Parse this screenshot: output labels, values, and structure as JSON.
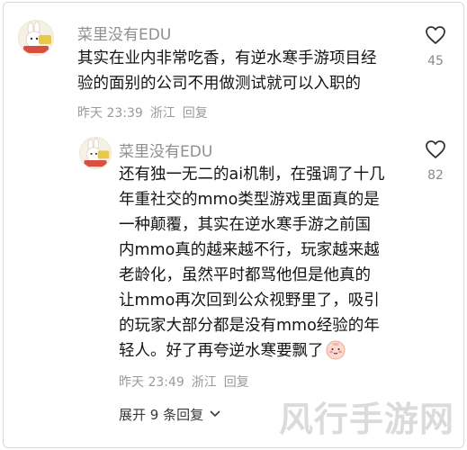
{
  "comments": [
    {
      "username": "菜里没有EDU",
      "avatar_badge": "小福篮",
      "lines": [
        "其实在业内非常吃香，有逆水寒手游项目经",
        "验的面别的公司不用做测试就可以入职的"
      ],
      "time": "昨天 23:39",
      "location": "浙江",
      "reply_label": "回复",
      "like_count": "45",
      "like_icon": "heart-outline-icon"
    },
    {
      "username": "菜里没有EDU",
      "avatar_badge": "小福篮",
      "lines": [
        "还有独一无二的ai机制，在强调了十几",
        "年重社交的mmo类型游戏里面真的是",
        "一种颠覆，其实在逆水寒手游之前国",
        "内mmo真的越来越不行，玩家越来越",
        "老龄化，虽然平时都骂他但是他真的",
        "让mmo再次回到公众视野里了，吸引",
        "的玩家大部分都是没有mmo经验的年",
        "轻人。好了再夸逆水寒要飘了"
      ],
      "time": "昨天 23:49",
      "location": "浙江",
      "reply_label": "回复",
      "like_count": "82",
      "like_icon": "heart-outline-icon",
      "emoji_icon": "blush-face-icon"
    }
  ],
  "expand_replies": "展开 9 条回复",
  "expand_icon": "chevron-down-icon",
  "watermark": "风行手游网"
}
